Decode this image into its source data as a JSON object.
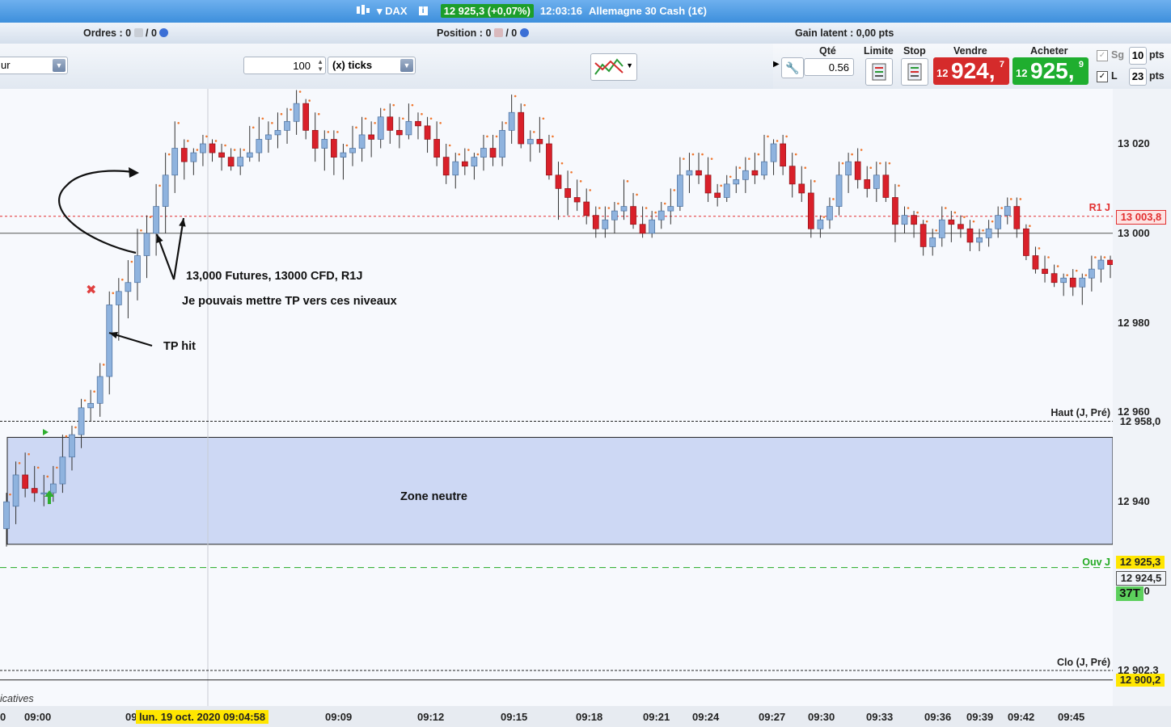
{
  "colors": {
    "up_candle": "#8fb3de",
    "down_candle": "#d9202a",
    "r1": "#e23030",
    "ouv": "#22aa22",
    "sell": "#d52b2b",
    "buy": "#1fae2f",
    "zone": "#cdd8f4",
    "highlight": "#ffe600"
  },
  "title": {
    "instrument": "DAX",
    "price_change": "12 925,3 (+0,07%)",
    "time": "12:03:16",
    "market": "Allemagne 30 Cash (1€)",
    "icons": [
      "chart-icon",
      "info-icon"
    ]
  },
  "infobar": {
    "orders_label": "Ordres :",
    "orders_value": "0",
    "orders_slash": "/ 0",
    "position_label": "Position :",
    "position_value": "0",
    "position_slash": "/ 0",
    "gain_label": "Gain latent :",
    "gain_value": "0,00 pts"
  },
  "toolbar": {
    "left_select": "ur",
    "qty_ticks": "100",
    "unit_select": "(x) ticks",
    "icons": [
      "chart-style-icon"
    ]
  },
  "trade": {
    "qty_label": "Qté",
    "qty_value": "0.56",
    "limit_label": "Limite",
    "stop_label": "Stop",
    "sell_label": "Vendre",
    "buy_label": "Acheter",
    "sell_small": "12",
    "sell_big": "924,",
    "sell_sup": "7",
    "buy_small": "12",
    "buy_big": "925,",
    "buy_sup": "9",
    "sg_label": "Sg",
    "sg_value": "10",
    "l_label": "L",
    "l_value": "23",
    "pts": "pts",
    "icons": [
      "wrench-icon",
      "limit-order-icon",
      "stop-order-icon"
    ]
  },
  "chart_data": {
    "type": "candlestick",
    "ylim": [
      12898,
      13033
    ],
    "yticks": [
      "13 020",
      "13 000",
      "12 980",
      "12 960",
      "12 940",
      "12 920",
      "12 902,3"
    ],
    "xticks": [
      "0",
      "09:00",
      "09:09",
      "09:12",
      "09:15",
      "09:18",
      "09:21",
      "09:24",
      "09:27",
      "09:30",
      "09:33",
      "09:36",
      "09:39",
      "09:42",
      "09:45"
    ],
    "cursor_label": "lun. 19 oct. 2020 09:04:58",
    "cursor_prefix": "09",
    "candles": [
      [
        12934,
        12942,
        12930,
        12940
      ],
      [
        12939,
        12949,
        12935,
        12946
      ],
      [
        12946,
        12951,
        12941,
        12943
      ],
      [
        12943,
        12948,
        12940,
        12942
      ],
      [
        12942,
        12946,
        12939,
        12942
      ],
      [
        12942,
        12948,
        12940,
        12944
      ],
      [
        12944,
        12955,
        12942,
        12950
      ],
      [
        12950,
        12957,
        12947,
        12955
      ],
      [
        12955,
        12963,
        12952,
        12961
      ],
      [
        12961,
        12965,
        12958,
        12962
      ],
      [
        12962,
        12971,
        12959,
        12968
      ],
      [
        12968,
        12987,
        12964,
        12984
      ],
      [
        12984,
        12990,
        12976,
        12987
      ],
      [
        12987,
        12994,
        12981,
        12989
      ],
      [
        12989,
        13001,
        12985,
        12995
      ],
      [
        12995,
        13004,
        12990,
        13000
      ],
      [
        13000,
        13011,
        12995,
        13006
      ],
      [
        13006,
        13018,
        13000,
        13013
      ],
      [
        13013,
        13025,
        13009,
        13019
      ],
      [
        13019,
        13021,
        13012,
        13016
      ],
      [
        13016,
        13019,
        13013,
        13018
      ],
      [
        13018,
        13022,
        13015,
        13020
      ],
      [
        13020,
        13021,
        13016,
        13018
      ],
      [
        13018,
        13020,
        13014,
        13017
      ],
      [
        13017,
        13019,
        13014,
        13015
      ],
      [
        13015,
        13019,
        13013,
        13017
      ],
      [
        13017,
        13024,
        13016,
        13018
      ],
      [
        13018,
        13026,
        13016,
        13021
      ],
      [
        13021,
        13025,
        13018,
        13022
      ],
      [
        13022,
        13027,
        13019,
        13023
      ],
      [
        13023,
        13028,
        13020,
        13025
      ],
      [
        13025,
        13032,
        13022,
        13029
      ],
      [
        13029,
        13030,
        13021,
        13023
      ],
      [
        13023,
        13027,
        13016,
        13019
      ],
      [
        13019,
        13023,
        13014,
        13021
      ],
      [
        13021,
        13023,
        13013,
        13017
      ],
      [
        13017,
        13020,
        13012,
        13018
      ],
      [
        13018,
        13024,
        13015,
        13019
      ],
      [
        13019,
        13026,
        13016,
        13022
      ],
      [
        13022,
        13025,
        13017,
        13021
      ],
      [
        13021,
        13028,
        13019,
        13026
      ],
      [
        13026,
        13029,
        13020,
        13023
      ],
      [
        13023,
        13026,
        13019,
        13022
      ],
      [
        13022,
        13029,
        13021,
        13025
      ],
      [
        13025,
        13027,
        13021,
        13024
      ],
      [
        13024,
        13026,
        13018,
        13021
      ],
      [
        13021,
        13025,
        13015,
        13017
      ],
      [
        13017,
        13020,
        13011,
        13013
      ],
      [
        13013,
        13018,
        13010,
        13016
      ],
      [
        13016,
        13019,
        13013,
        13015
      ],
      [
        13015,
        13018,
        13012,
        13017
      ],
      [
        13017,
        13022,
        13014,
        13019
      ],
      [
        13019,
        13022,
        13015,
        13017
      ],
      [
        13017,
        13025,
        13015,
        13023
      ],
      [
        13023,
        13031,
        13020,
        13027
      ],
      [
        13027,
        13029,
        13019,
        13020
      ],
      [
        13020,
        13023,
        13016,
        13021
      ],
      [
        13021,
        13026,
        13018,
        13020
      ],
      [
        13020,
        13022,
        13012,
        13013
      ],
      [
        13013,
        13016,
        13003,
        13010
      ],
      [
        13010,
        13014,
        13004,
        13008
      ],
      [
        13008,
        13012,
        13005,
        13007
      ],
      [
        13007,
        13010,
        13002,
        13004
      ],
      [
        13004,
        13006,
        12999,
        13001
      ],
      [
        13001,
        13006,
        12999,
        13003
      ],
      [
        13003,
        13007,
        13000,
        13005
      ],
      [
        13005,
        13012,
        13003,
        13006
      ],
      [
        13006,
        13009,
        13001,
        13002
      ],
      [
        13002,
        13006,
        12999,
        13000
      ],
      [
        13000,
        13005,
        12999,
        13003
      ],
      [
        13003,
        13007,
        13001,
        13005
      ],
      [
        13005,
        13010,
        13002,
        13006
      ],
      [
        13006,
        13017,
        13005,
        13013
      ],
      [
        13013,
        13018,
        13009,
        13014
      ],
      [
        13014,
        13018,
        13011,
        13013
      ],
      [
        13013,
        13017,
        13007,
        13009
      ],
      [
        13009,
        13011,
        13006,
        13008
      ],
      [
        13008,
        13013,
        13007,
        13011
      ],
      [
        13011,
        13015,
        13009,
        13012
      ],
      [
        13012,
        13017,
        13009,
        13014
      ],
      [
        13014,
        13018,
        13011,
        13013
      ],
      [
        13013,
        13022,
        13012,
        13016
      ],
      [
        13016,
        13021,
        13013,
        13020
      ],
      [
        13020,
        13022,
        13013,
        13015
      ],
      [
        13015,
        13018,
        13008,
        13011
      ],
      [
        13011,
        13015,
        13007,
        13009
      ],
      [
        13009,
        13012,
        12999,
        13001
      ],
      [
        13001,
        13004,
        12999,
        13003
      ],
      [
        13003,
        13008,
        13001,
        13006
      ],
      [
        13006,
        13016,
        13004,
        13013
      ],
      [
        13013,
        13018,
        13009,
        13016
      ],
      [
        13016,
        13019,
        13010,
        13012
      ],
      [
        13012,
        13015,
        13008,
        13010
      ],
      [
        13010,
        13016,
        13007,
        13013
      ],
      [
        13013,
        13016,
        13007,
        13008
      ],
      [
        13008,
        13011,
        12998,
        13002
      ],
      [
        13002,
        13006,
        13000,
        13004
      ],
      [
        13004,
        13005,
        12999,
        13002
      ],
      [
        13002,
        13003,
        12995,
        12997
      ],
      [
        12997,
        13001,
        12995,
        12999
      ],
      [
        12999,
        13006,
        12997,
        13003
      ],
      [
        13003,
        13005,
        12998,
        13002
      ],
      [
        13002,
        13004,
        12999,
        13001
      ],
      [
        13001,
        13003,
        12996,
        12998
      ],
      [
        12998,
        13001,
        12996,
        12999
      ],
      [
        12999,
        13003,
        12997,
        13001
      ],
      [
        13001,
        13006,
        12999,
        13004
      ],
      [
        13004,
        13008,
        13002,
        13006
      ],
      [
        13006,
        13008,
        12999,
        13001
      ],
      [
        13001,
        13002,
        12994,
        12995
      ],
      [
        12995,
        12997,
        12991,
        12992
      ],
      [
        12992,
        12995,
        12989,
        12991
      ],
      [
        12991,
        12993,
        12988,
        12989
      ],
      [
        12989,
        12991,
        12986,
        12990
      ],
      [
        12990,
        12992,
        12986,
        12988
      ],
      [
        12988,
        12991,
        12984,
        12990
      ],
      [
        12990,
        12995,
        12987,
        12992
      ],
      [
        12992,
        12995,
        12989,
        12994
      ],
      [
        12994,
        12995,
        12990,
        12993
      ]
    ],
    "levels": [
      {
        "name": "R1 J",
        "value": "13 003,8"
      },
      {
        "name": "Haut (J, Pré)",
        "value": "12 958,0"
      },
      {
        "name": "Ouv J",
        "value": "12 925,3"
      },
      {
        "name": "",
        "value": "12 924,5"
      },
      {
        "name": "Clo (J, Pré)",
        "value": "12 900,2"
      }
    ],
    "annotations": [
      "13,000 Futures, 13000 CFD, R1J",
      "Je pouvais mettre TP vers ces niveaux",
      "TP hit",
      "Zone neutre"
    ],
    "volume_badge": "37T",
    "footer_text": "icatives"
  }
}
